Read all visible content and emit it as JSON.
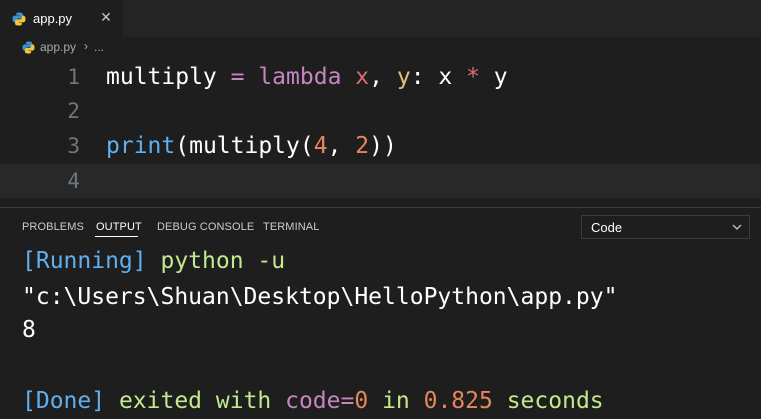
{
  "tab": {
    "filename": "app.py",
    "close": "✕"
  },
  "breadcrumb": {
    "file": "app.py",
    "separator": "›",
    "more": "..."
  },
  "editor": {
    "lines": [
      {
        "number": "1",
        "tokens": {
          "a": "multiply",
          "b": " = ",
          "c": "lambda",
          "d": " x",
          "e": ", ",
          "f": "y",
          "g": ": x ",
          "h": "*",
          "i": " y"
        }
      },
      {
        "number": "2"
      },
      {
        "number": "3",
        "tokens": {
          "a": "print",
          "b": "(multiply(",
          "c": "4",
          "d": ", ",
          "e": "2",
          "f": "))"
        }
      },
      {
        "number": "4"
      }
    ]
  },
  "panel": {
    "tabs": [
      "PROBLEMS",
      "OUTPUT",
      "DEBUG CONSOLE",
      "TERMINAL"
    ],
    "active_tab": "OUTPUT",
    "select_value": "Code"
  },
  "output": {
    "running_tag": "[Running]",
    "command": " python -u",
    "path": "\"c:\\Users\\Shuan\\Desktop\\HelloPython\\app.py\"",
    "result": "8",
    "done_tag": "[Done]",
    "exited_text": " exited with ",
    "code_label": "code=",
    "code_value": "0",
    "in_text": " in ",
    "duration": "0.825",
    "seconds_text": " seconds"
  },
  "colors": {
    "background": "#1e1e1e",
    "keyword": "#c586c0",
    "function": "#61afef",
    "number": "#e5865c"
  }
}
